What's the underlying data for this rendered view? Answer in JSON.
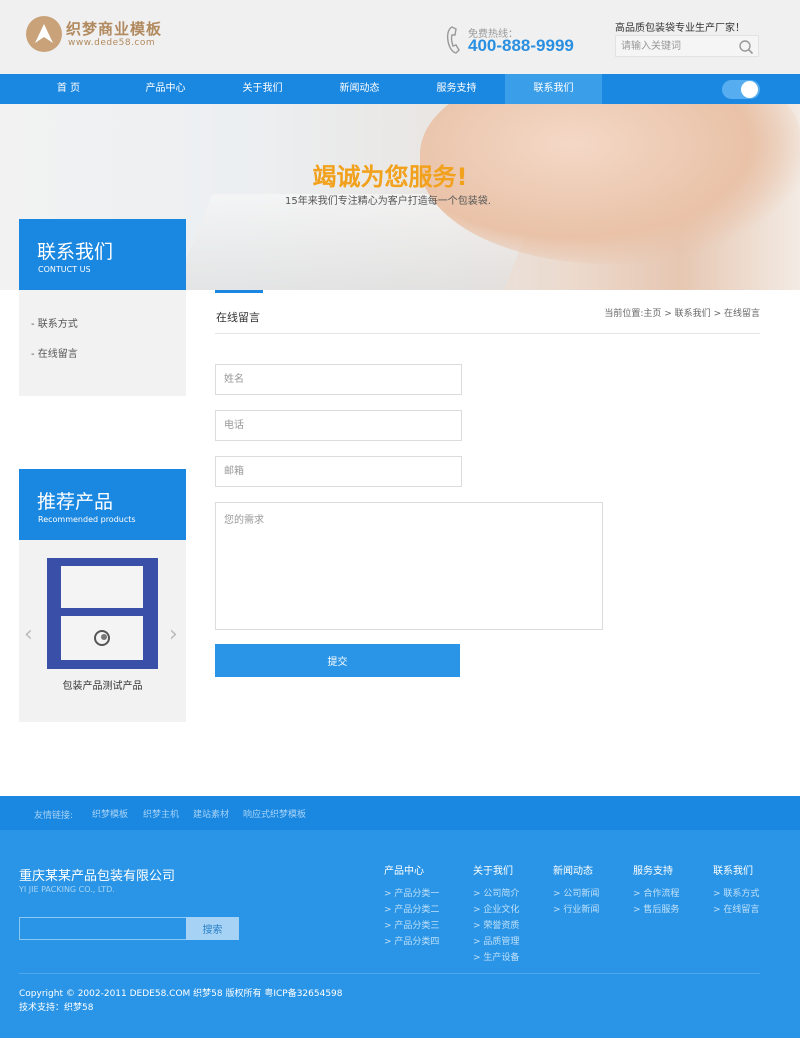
{
  "header": {
    "logo_title": "织梦商业模板",
    "logo_url": "www.dede58.com",
    "hotline_label": "免费热线：",
    "hotline_number": "400-888-9999",
    "slogan": "高品质包装袋专业生产厂家！",
    "search_placeholder": "请输入关键词"
  },
  "nav": {
    "items": [
      "首 页",
      "产品中心",
      "关于我们",
      "新闻动态",
      "服务支持",
      "联系我们"
    ],
    "active": "联系我们"
  },
  "banner": {
    "headline": "竭诚为您服务!",
    "subline": "15年来我们专注精心为客户打造每一个包装袋."
  },
  "sidebar": {
    "contact": {
      "title": "联系我们",
      "subtitle": "CONTUCT US",
      "links": [
        "联系方式",
        "在线留言"
      ]
    },
    "recommended": {
      "title": "推荐产品",
      "subtitle": "Recommended products",
      "product_caption": "包装产品测试产品",
      "prev_arrow": "‹",
      "next_arrow": "›"
    }
  },
  "main": {
    "title": "在线留言",
    "breadcrumb": {
      "prefix": "当前位置:",
      "items": [
        "主页",
        "联系我们",
        "在线留言"
      ],
      "separator": ">"
    },
    "form": {
      "name_placeholder": "姓名",
      "phone_placeholder": "电话",
      "email_placeholder": "邮箱",
      "message_placeholder": "您的需求",
      "submit_label": "提交"
    }
  },
  "friend_links": {
    "label": "友情链接:",
    "items": [
      "织梦模板",
      "织梦主机",
      "建站素材",
      "响应式织梦模板"
    ]
  },
  "footer": {
    "company_name": "重庆某某产品包装有限公司",
    "company_en": "YI JIE PACKING CO., LTD.",
    "search_button": "搜索",
    "columns": [
      {
        "title": "产品中心",
        "links": [
          "产品分类一",
          "产品分类二",
          "产品分类三",
          "产品分类四"
        ]
      },
      {
        "title": "关于我们",
        "links": [
          "公司简介",
          "企业文化",
          "荣誉资质",
          "品质管理",
          "生产设备"
        ]
      },
      {
        "title": "新闻动态",
        "links": [
          "公司新闻",
          "行业新闻"
        ]
      },
      {
        "title": "服务支持",
        "links": [
          "合作流程",
          "售后服务"
        ]
      },
      {
        "title": "联系我们",
        "links": [
          "联系方式",
          "在线留言"
        ]
      }
    ],
    "link_bullet": ">",
    "copyright": "Copyright © 2002-2011 DEDE58.COM 织梦58 版权所有 粤ICP备32654598",
    "support": "技术支持：织梦58"
  },
  "colors": {
    "primary": "#1a87e0",
    "footer_bg": "#2a95e6",
    "accent_orange": "#f2a11c",
    "logo_gold": "#b28a5f"
  },
  "icons": [
    "logo-emblem-icon",
    "phone-icon",
    "search-icon",
    "chevron-left-icon",
    "chevron-right-icon"
  ]
}
